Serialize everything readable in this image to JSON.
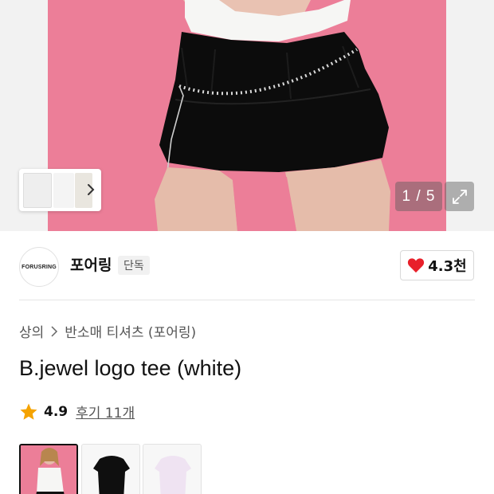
{
  "gallery": {
    "counter": "1 / 5",
    "icons": {
      "next": "chevron-right-icon",
      "expand": "expand-icon"
    }
  },
  "brand": {
    "logo_text": "FORUSRING",
    "name": "포어링",
    "badge": "단독"
  },
  "like": {
    "icon": "heart-icon",
    "count": "4.3천",
    "color": "#e8202a"
  },
  "product": {
    "breadcrumb": [
      "상의",
      "반소매 티셔츠 (포어링)"
    ],
    "title": "B.jewel logo tee (white)",
    "rating": {
      "icon": "star-icon",
      "score": "4.9",
      "reviews": "후기 11개",
      "star_color": "#f5a300"
    }
  },
  "options": [
    {
      "label": "model-photo",
      "selected": true
    },
    {
      "label": "black-tee",
      "selected": false
    },
    {
      "label": "lavender-tee",
      "selected": false
    }
  ]
}
